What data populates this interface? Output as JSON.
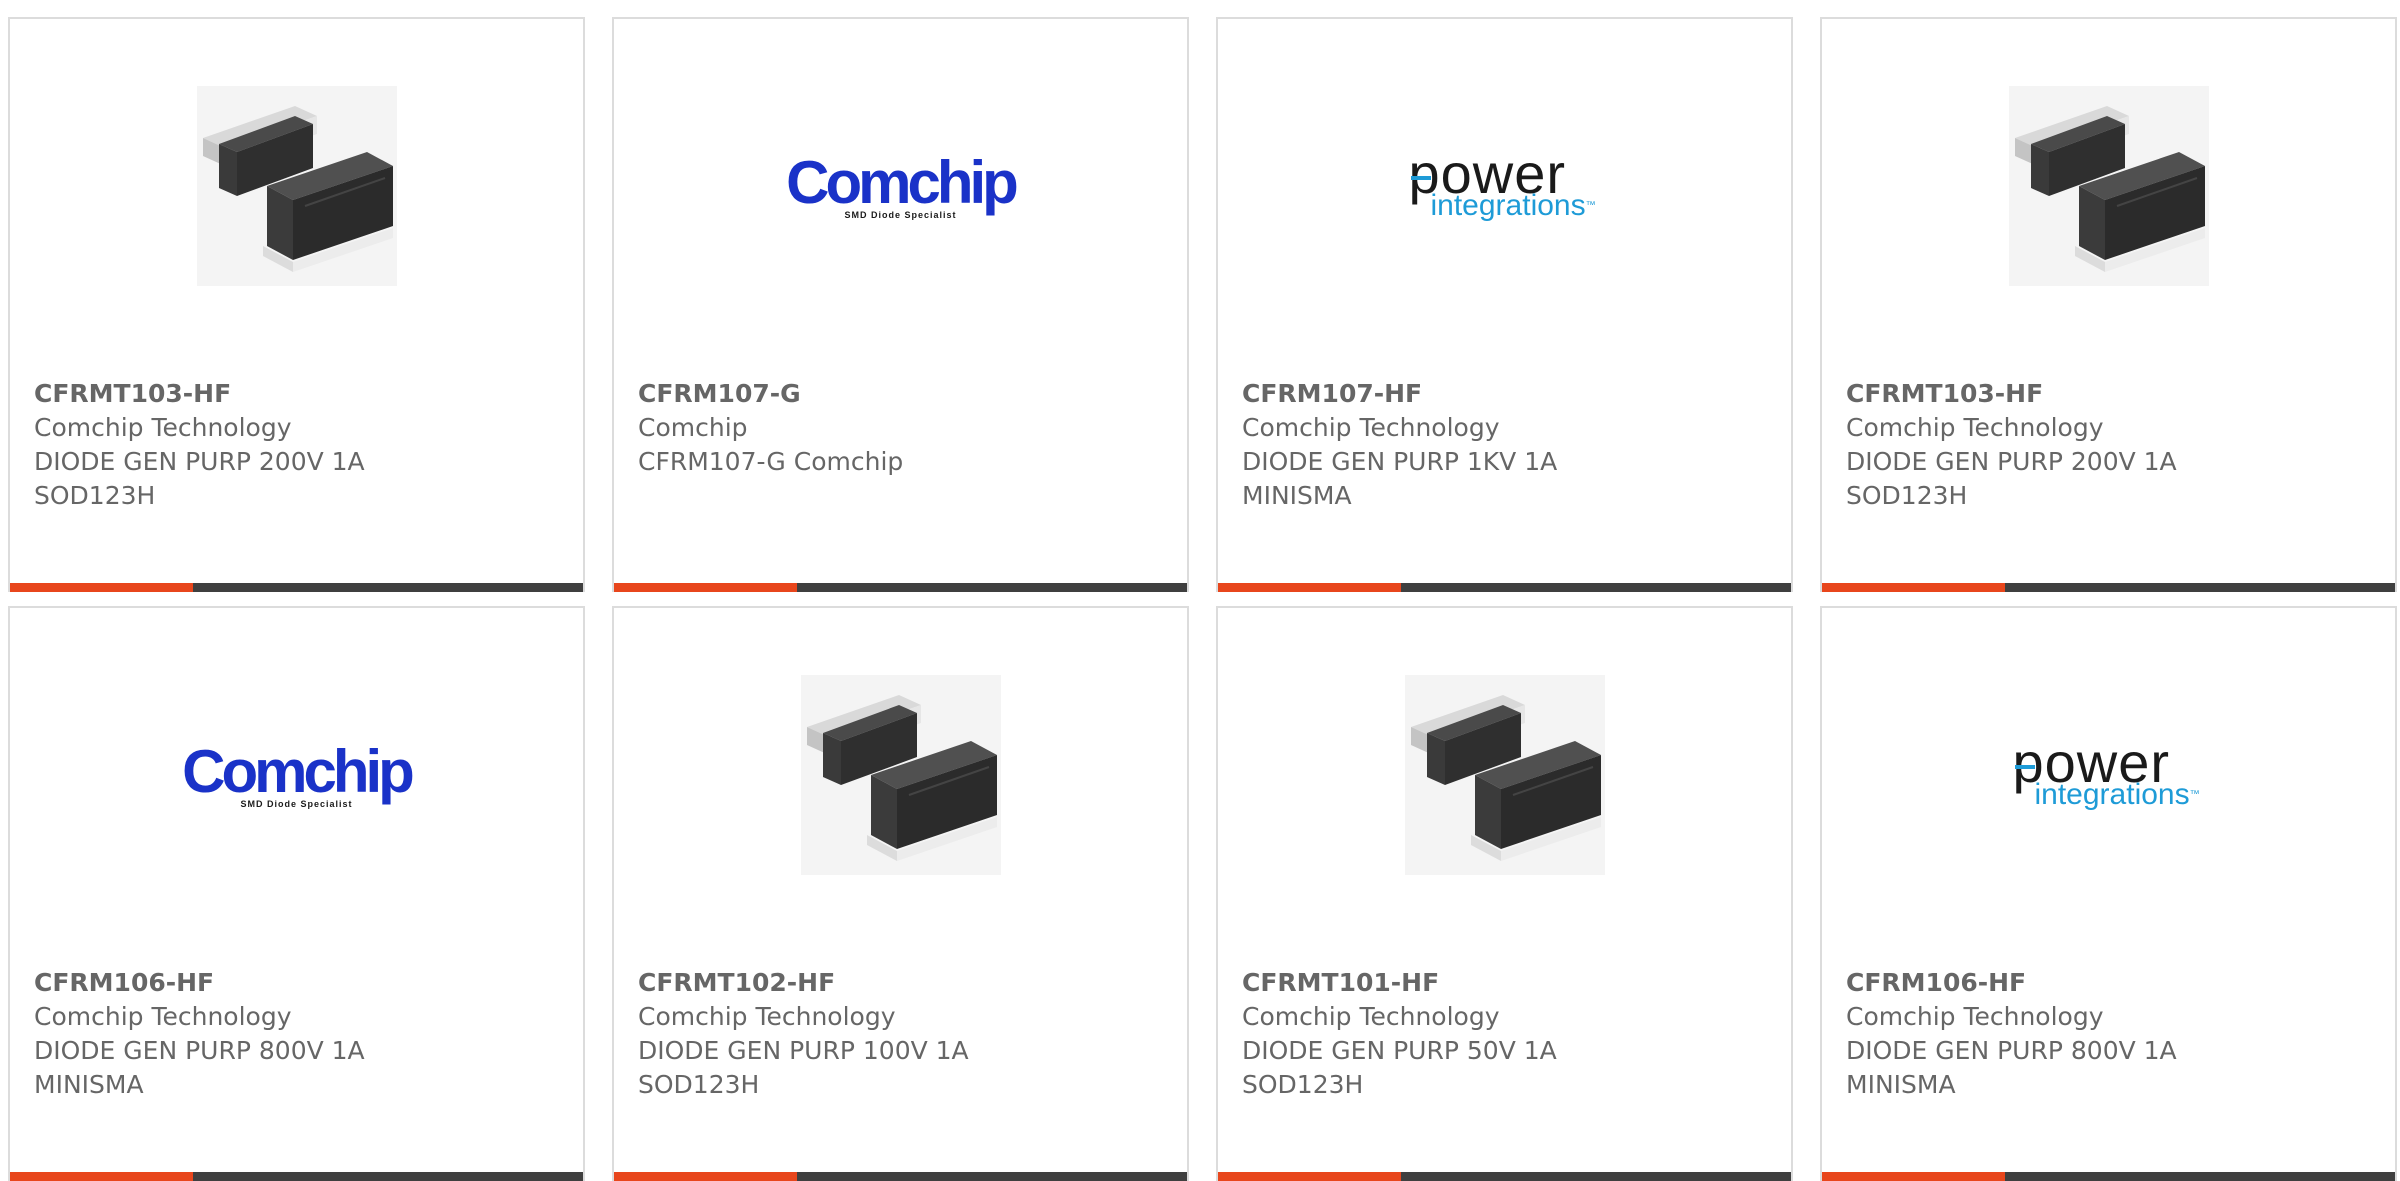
{
  "cards": [
    {
      "part_number": "CFRMT103-HF",
      "manufacturer": "Comchip Technology",
      "description_line1": "DIODE GEN PURP 200V 1A",
      "description_line2": "SOD123H",
      "image": "sod123h-package-photo"
    },
    {
      "part_number": "CFRM107-G",
      "manufacturer": "Comchip",
      "description_line1": "CFRM107-G Comchip",
      "description_line2": "",
      "image": "comchip-logo"
    },
    {
      "part_number": "CFRM107-HF",
      "manufacturer": "Comchip Technology",
      "description_line1": "DIODE GEN PURP 1KV 1A",
      "description_line2": "MINISMA",
      "image": "power-integrations-logo"
    },
    {
      "part_number": "CFRMT103-HF",
      "manufacturer": "Comchip Technology",
      "description_line1": "DIODE GEN PURP 200V 1A",
      "description_line2": "SOD123H",
      "image": "sod123h-package-photo"
    },
    {
      "part_number": "CFRM106-HF",
      "manufacturer": "Comchip Technology",
      "description_line1": "DIODE GEN PURP 800V 1A",
      "description_line2": "MINISMA",
      "image": "comchip-logo"
    },
    {
      "part_number": "CFRMT102-HF",
      "manufacturer": "Comchip Technology",
      "description_line1": "DIODE GEN PURP 100V 1A",
      "description_line2": "SOD123H",
      "image": "sod123h-package-photo"
    },
    {
      "part_number": "CFRMT101-HF",
      "manufacturer": "Comchip Technology",
      "description_line1": "DIODE GEN PURP 50V 1A",
      "description_line2": "SOD123H",
      "image": "sod123h-package-photo"
    },
    {
      "part_number": "CFRM106-HF",
      "manufacturer": "Comchip Technology",
      "description_line1": "DIODE GEN PURP 800V 1A",
      "description_line2": "MINISMA",
      "image": "power-integrations-logo"
    }
  ],
  "logos": {
    "comchip_word": "Comchip",
    "comchip_tagline": "SMD Diode Specialist",
    "power_word": "power",
    "integrations_word": "integrations",
    "tm": "™"
  },
  "colors": {
    "text": "#666666",
    "card_border": "#dcdcdc",
    "bar_dark": "#3f3f3f",
    "bar_accent": "#e8461c",
    "comchip_blue": "#1a32c8",
    "power_integrations_blue": "#1e9bd7"
  }
}
